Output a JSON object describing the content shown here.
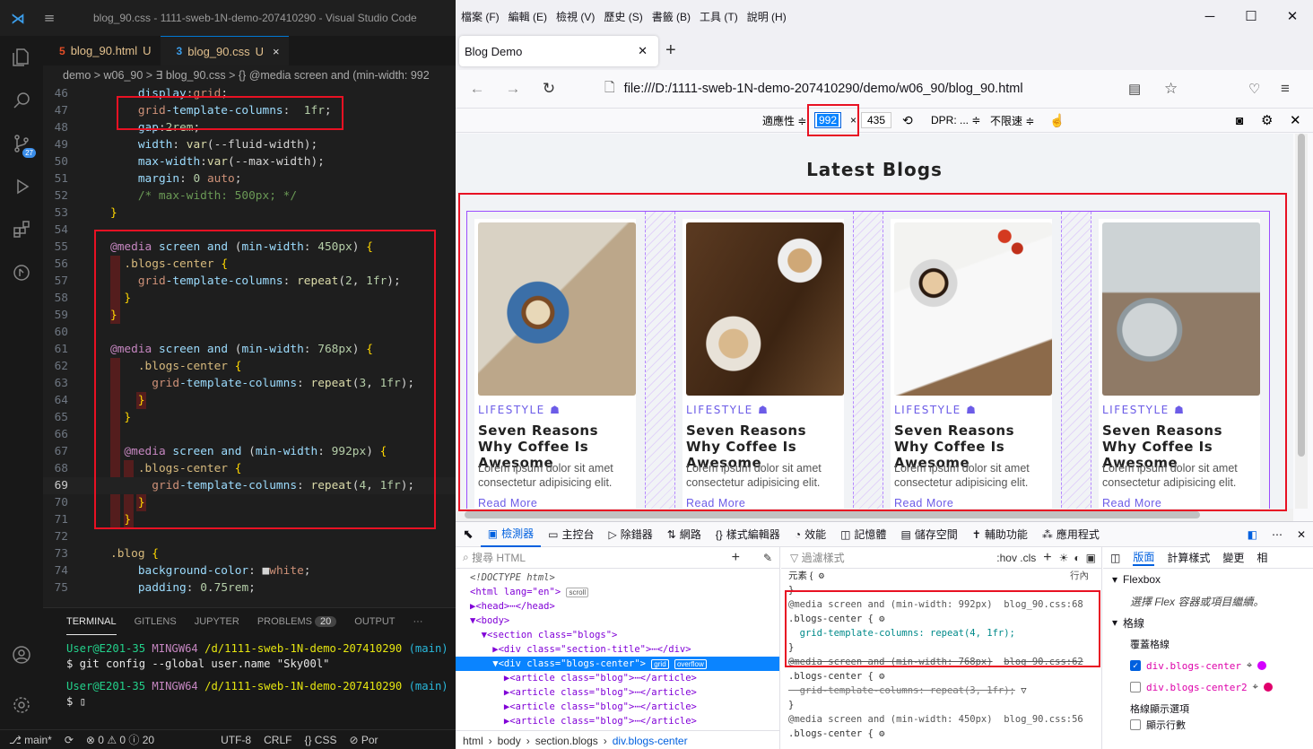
{
  "vscode": {
    "window_title": "blog_90.css - 1111-sweb-1N-demo-207410290 - Visual Studio Code",
    "tabs": [
      {
        "icon": "5",
        "label": "blog_90.html",
        "status": "U"
      },
      {
        "icon": "3",
        "label": "blog_90.css",
        "status": "U",
        "close": "×"
      }
    ],
    "breadcrumb": "demo > w06_90 > ∃ blog_90.css > {} @media screen and (min-width: 992",
    "source_control_badge": "27",
    "editor_lines": [
      {
        "num": "46",
        "text": "    display:grid;"
      },
      {
        "num": "47",
        "text": "    grid-template-columns:  1fr;"
      },
      {
        "num": "48",
        "text": "    gap:2rem;"
      },
      {
        "num": "49",
        "text": "    width: var(--fluid-width);"
      },
      {
        "num": "50",
        "text": "    max-width:var(--max-width);"
      },
      {
        "num": "51",
        "text": "    margin: 0 auto;"
      },
      {
        "num": "52",
        "text": "    /* max-width: 500px; */"
      },
      {
        "num": "53",
        "text": "}"
      },
      {
        "num": "54",
        "text": ""
      },
      {
        "num": "55",
        "text": "@media screen and (min-width: 450px) {"
      },
      {
        "num": "56",
        "text": "  .blogs-center {"
      },
      {
        "num": "57",
        "text": "    grid-template-columns: repeat(2, 1fr);"
      },
      {
        "num": "58",
        "text": "  }"
      },
      {
        "num": "59",
        "text": "}"
      },
      {
        "num": "60",
        "text": ""
      },
      {
        "num": "61",
        "text": "@media screen and (min-width: 768px) {"
      },
      {
        "num": "62",
        "text": "    .blogs-center {"
      },
      {
        "num": "63",
        "text": "      grid-template-columns: repeat(3, 1fr);"
      },
      {
        "num": "64",
        "text": "    }"
      },
      {
        "num": "65",
        "text": "  }"
      },
      {
        "num": "66",
        "text": ""
      },
      {
        "num": "67",
        "text": "  @media screen and (min-width: 992px) {"
      },
      {
        "num": "68",
        "text": "    .blogs-center {"
      },
      {
        "num": "69",
        "text": "      grid-template-columns: repeat(4, 1fr);"
      },
      {
        "num": "70",
        "text": "    }"
      },
      {
        "num": "71",
        "text": "  }"
      },
      {
        "num": "72",
        "text": ""
      },
      {
        "num": "73",
        "text": ".blog {"
      },
      {
        "num": "74",
        "text": "    background-color: ■white;"
      },
      {
        "num": "75",
        "text": "    padding: 0.75rem;"
      }
    ],
    "terminal": {
      "tabs": [
        "TERMINAL",
        "GITLENS",
        "JUPYTER",
        "PROBLEMS",
        "OUTPUT",
        "···"
      ],
      "problems_count": "20",
      "prompt1_user": "User@E201-35",
      "prompt1_sys": "MINGW64",
      "prompt1_path": "/d/1111-sweb-1N-demo-207410290",
      "prompt1_branch": "(main)",
      "command1": "$ git config --global user.name \"Sky00l\"",
      "prompt2_user": "User@E201-35",
      "prompt2_sys": "MINGW64",
      "prompt2_path": "/d/1111-sweb-1N-demo-207410290",
      "prompt2_branch": "(main)",
      "command2": "$ ▯"
    },
    "status": {
      "branch": "main*",
      "sync": "⟳",
      "problems": "⊗ 0 ⚠ 0 ⓘ 20",
      "encoding": "UTF-8",
      "eol": "CRLF",
      "language": "{} CSS",
      "port": "⊘ Por"
    }
  },
  "firefox": {
    "menu": [
      "檔案 (F)",
      "編輯 (E)",
      "檢視 (V)",
      "歷史 (S)",
      "書籤 (B)",
      "工具 (T)",
      "說明 (H)"
    ],
    "tab_title": "Blog Demo",
    "url": "file:///D:/1111-sweb-1N-demo-207410290/demo/w06_90/blog_90.html",
    "rdm": {
      "responsive": "適應性 ≑",
      "width": "992",
      "times": "×",
      "height": "435",
      "dpr": "DPR: ... ≑",
      "throttle": "不限速 ≑"
    },
    "page": {
      "section_title": "Latest Blogs",
      "cards": [
        {
          "category": "LIFESTYLE",
          "title": "Seven Reasons Why Coffee Is Awesome",
          "desc": "Lorem ipsum dolor sit amet consectetur adipisicing elit.",
          "more": "Read More"
        },
        {
          "category": "LIFESTYLE",
          "title": "Seven Reasons Why Coffee Is Awesome",
          "desc": "Lorem ipsum dolor sit amet consectetur adipisicing elit.",
          "more": "Read More"
        },
        {
          "category": "LIFESTYLE",
          "title": "Seven Reasons Why Coffee Is Awesome",
          "desc": "Lorem ipsum dolor sit amet consectetur adipisicing elit.",
          "more": "Read More"
        },
        {
          "category": "LIFESTYLE",
          "title": "Seven Reasons Why Coffee Is Awesome",
          "desc": "Lorem ipsum dolor sit amet consectetur adipisicing elit.",
          "more": "Read More"
        }
      ]
    },
    "devtools": {
      "tabs": [
        "檢測器",
        "主控台",
        "除錯器",
        "網路",
        "樣式編輯器",
        "效能",
        "記憶體",
        "儲存空間",
        "輔助功能",
        "應用程式"
      ],
      "html_search": "搜尋 HTML",
      "tree": [
        "<!DOCTYPE html>",
        "<html lang=\"en\">",
        "▶<head>⋯</head>",
        "▼<body>",
        "  ▼<section class=\"blogs\">",
        "    ▶<div class=\"section-title\">⋯</div>",
        "    ▼<div class=\"blogs-center\">",
        "      ▶<article class=\"blog\">⋯</article>",
        "      ▶<article class=\"blog\">⋯</article>",
        "      ▶<article class=\"blog\">⋯</article>",
        "      ▶<article class=\"blog\">⋯</article>"
      ],
      "pills": {
        "scroll": "scroll",
        "grid": "grid",
        "overflow": "overflow"
      },
      "breadcrumb": [
        "html",
        "body",
        "section.blogs",
        "div.blogs-center"
      ],
      "filter_styles": "過濾樣式",
      "pseudo": ":hov .cls",
      "rules": [
        {
          "text": "元素 {",
          "src": "行內"
        },
        {
          "text": "}",
          "src": ""
        },
        {
          "text": "@media screen and (min-width: 992px)",
          "src": "blog_90.css:68"
        },
        {
          "text": ".blogs-center {",
          "src": ""
        },
        {
          "text": "  grid-template-columns: repeat(4, 1fr);",
          "src": ""
        },
        {
          "text": "}",
          "src": ""
        },
        {
          "text": "@media screen and (min-width: 768px)",
          "src": "blog_90.css:62"
        },
        {
          "text": ".blogs-center {",
          "src": ""
        },
        {
          "text": "  grid-template-columns: repeat(3, 1fr);",
          "src": ""
        },
        {
          "text": "}",
          "src": ""
        },
        {
          "text": "@media screen and (min-width: 450px)",
          "src": "blog_90.css:56"
        },
        {
          "text": ".blogs-center {",
          "src": ""
        }
      ],
      "layout_tabs": [
        "版面",
        "計算樣式",
        "變更",
        "相"
      ],
      "flexbox": "Flexbox",
      "flex_hint": "選擇 Flex 容器或項目繼續。",
      "grid": "格線",
      "overlay_grid": "覆蓋格線",
      "grid_items": [
        "div.blogs-center",
        "div.blogs-center2"
      ],
      "grid_display": "格線顯示選項",
      "grid_display_sub": "顯示行數"
    }
  }
}
